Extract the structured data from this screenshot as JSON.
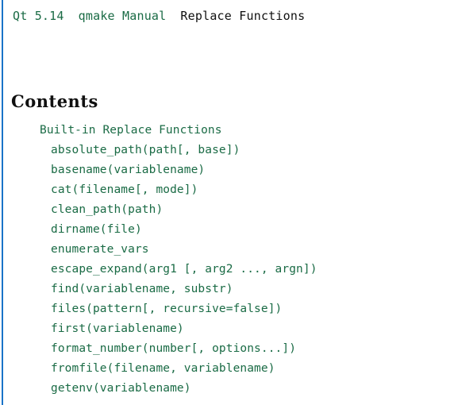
{
  "page": {
    "background_color": "#ffffff",
    "accent_rule_color": "#1a73c8",
    "link_color": "#1a6b45",
    "text_color": "#101010"
  },
  "breadcrumb": {
    "items": [
      {
        "label": "Qt 5.14",
        "current": false
      },
      {
        "label": "qmake Manual",
        "current": false
      },
      {
        "label": "Replace Functions",
        "current": true
      }
    ]
  },
  "contents": {
    "heading": "Contents",
    "items": [
      {
        "label": "Built-in Replace Functions",
        "level": 1
      },
      {
        "label": "absolute_path(path[, base])",
        "level": 2
      },
      {
        "label": "basename(variablename)",
        "level": 2
      },
      {
        "label": "cat(filename[, mode])",
        "level": 2
      },
      {
        "label": "clean_path(path)",
        "level": 2
      },
      {
        "label": "dirname(file)",
        "level": 2
      },
      {
        "label": "enumerate_vars",
        "level": 2
      },
      {
        "label": "escape_expand(arg1 [, arg2 ..., argn])",
        "level": 2
      },
      {
        "label": "find(variablename, substr)",
        "level": 2
      },
      {
        "label": "files(pattern[, recursive=false])",
        "level": 2
      },
      {
        "label": "first(variablename)",
        "level": 2
      },
      {
        "label": "format_number(number[, options...])",
        "level": 2
      },
      {
        "label": "fromfile(filename, variablename)",
        "level": 2
      },
      {
        "label": "getenv(variablename)",
        "level": 2
      }
    ]
  }
}
